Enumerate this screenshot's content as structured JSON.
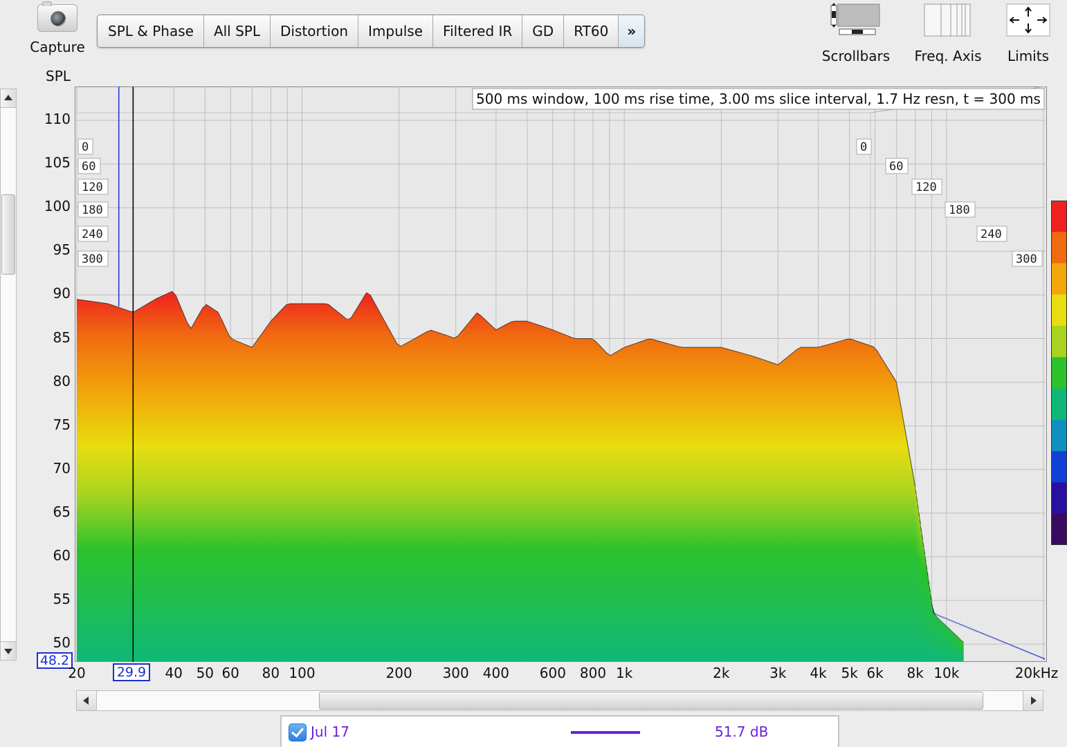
{
  "toolbar": {
    "capture_label": "Capture",
    "tabs": [
      {
        "label": "SPL & Phase"
      },
      {
        "label": "All SPL"
      },
      {
        "label": "Distortion"
      },
      {
        "label": "Impulse"
      },
      {
        "label": "Filtered IR"
      },
      {
        "label": "GD"
      },
      {
        "label": "RT60"
      }
    ],
    "more_label": "»",
    "scrollbars_label": "Scrollbars",
    "freq_axis_label": "Freq. Axis",
    "limits_label": "Limits"
  },
  "plot": {
    "y_axis_title": "SPL",
    "info_text": "500 ms window, 100 ms rise time, 3.00 ms slice interval, 1.7 Hz resn, t = 300 ms",
    "y_ticks": [
      "110",
      "105",
      "100",
      "95",
      "90",
      "85",
      "80",
      "75",
      "70",
      "65",
      "60",
      "55",
      "50"
    ],
    "x_ticks": [
      "20",
      "40",
      "50",
      "60",
      "80",
      "100",
      "200",
      "300",
      "400",
      "600",
      "800",
      "1k",
      "2k",
      "3k",
      "4k",
      "5k",
      "6k",
      "8k",
      "10k",
      "20kHz"
    ],
    "time_labels": [
      "0",
      "60",
      "120",
      "180",
      "240",
      "300"
    ],
    "y_cursor_value": "48.2",
    "x_cursor_value": "29.9"
  },
  "legend": {
    "name": "Jul 17",
    "value": "51.7 dB",
    "checked": true,
    "line_color": "#6a1fd8"
  },
  "colors": {
    "cursor": "#1a2fd0",
    "colormap": [
      "#ef2020",
      "#f06a10",
      "#f2a80a",
      "#e8dd10",
      "#a8d420",
      "#2cc22c",
      "#10b878",
      "#1090c0",
      "#1040d8",
      "#2a10a0",
      "#380a60"
    ]
  },
  "chart_data": {
    "type": "area",
    "title": "",
    "xlabel": "",
    "ylabel": "SPL",
    "xscale": "log",
    "xlim": [
      20,
      20000
    ],
    "ylim": [
      48.2,
      112
    ],
    "slices_ms": [
      0,
      60,
      120,
      180,
      240,
      300
    ],
    "front_slice_peak_curve": {
      "x": [
        20,
        25,
        29.9,
        35,
        40,
        45,
        50,
        55,
        60,
        70,
        80,
        90,
        100,
        120,
        140,
        160,
        200,
        250,
        300,
        350,
        400,
        450,
        500,
        600,
        700,
        800,
        900,
        1000,
        1200,
        1500,
        2000,
        2500,
        3000,
        3500,
        4000,
        5000,
        6000,
        7000,
        8000
      ],
      "y": [
        89.5,
        89,
        88,
        89.5,
        90.5,
        86,
        89,
        88,
        85,
        84,
        87,
        89,
        89,
        89,
        87,
        90.5,
        84,
        86,
        85,
        88,
        86,
        87,
        87,
        86,
        85,
        85,
        83,
        84,
        85,
        84,
        84,
        83,
        82,
        84,
        84,
        85,
        84,
        80,
        68
      ]
    },
    "back_slice_floor_db": 55
  }
}
